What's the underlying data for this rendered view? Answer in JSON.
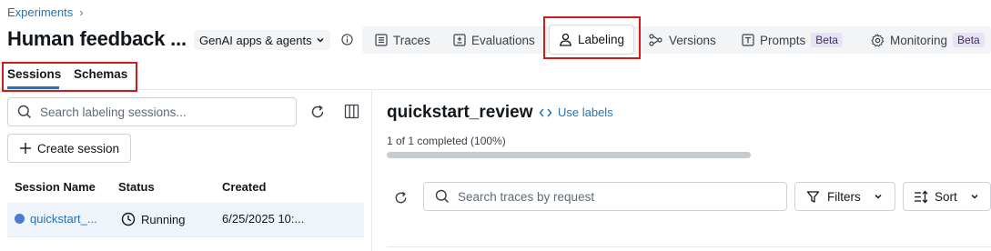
{
  "breadcrumb": {
    "parent": "Experiments",
    "separator": "›"
  },
  "header": {
    "title": "Human feedback ...",
    "type_select": "GenAI apps & agents"
  },
  "tabs": [
    {
      "label": "Traces",
      "icon": "list-icon"
    },
    {
      "label": "Evaluations",
      "icon": "evaluation-icon"
    },
    {
      "label": "Labeling",
      "icon": "user-icon",
      "active": true
    },
    {
      "label": "Versions",
      "icon": "versions-icon"
    },
    {
      "label": "Prompts",
      "icon": "prompt-icon",
      "badge": "Beta"
    },
    {
      "label": "Monitoring",
      "icon": "gear-icon",
      "badge": "Beta"
    }
  ],
  "subtabs": [
    {
      "label": "Sessions",
      "active": true
    },
    {
      "label": "Schemas"
    }
  ],
  "sessions_panel": {
    "search_placeholder": "Search labeling sessions...",
    "create_label": "Create session",
    "columns": [
      "Session Name",
      "Status",
      "Created"
    ],
    "rows": [
      {
        "name": "quickstart_...",
        "status": "Running",
        "created": "6/25/2025 10:..."
      }
    ]
  },
  "detail": {
    "title": "quickstart_review",
    "use_labels": "Use labels",
    "progress_text": "1 of 1 completed (100%)",
    "progress": 1.0,
    "trace_search_placeholder": "Search traces by request",
    "filters_label": "Filters",
    "sort_label": "Sort"
  },
  "colors": {
    "accent": "#2272b4",
    "highlight": "#d11a1a",
    "row_selected": "#eef4fa"
  }
}
